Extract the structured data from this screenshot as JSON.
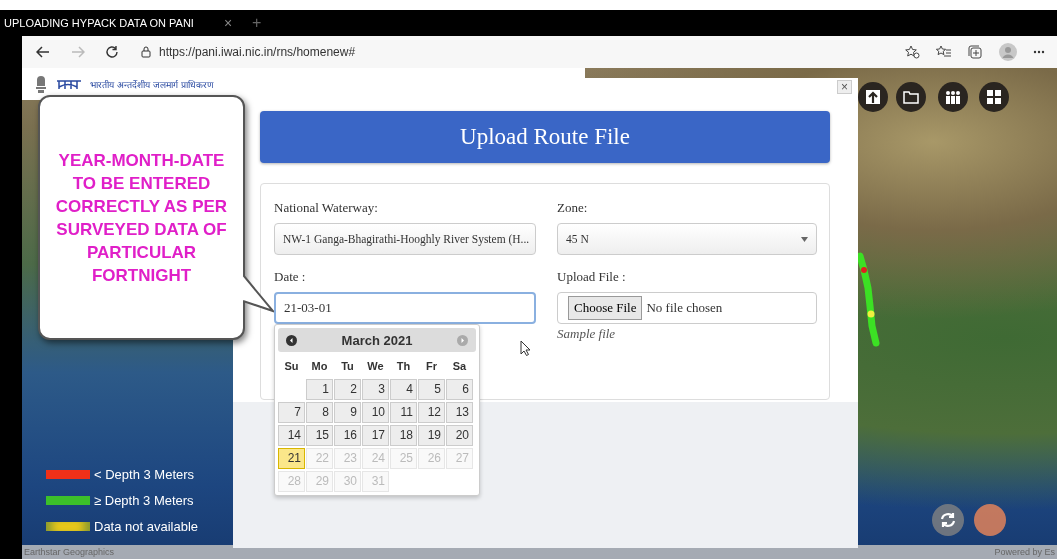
{
  "browser": {
    "tab_title": "UPLOADING HYPACK DATA ON PANI",
    "tab_close": "×",
    "new_tab": "+",
    "url": "https://pani.iwai.nic.in/rns/homenew#"
  },
  "page_header": {
    "org_name": "भारतीय अन्तर्देशीय जलमार्ग प्राधिकरण"
  },
  "callout": {
    "text": "YEAR-MONTH-DATE TO BE ENTERED CORRECTLY AS PER SURVEYED DATA OF PARTICULAR FORTNIGHT"
  },
  "modal": {
    "close": "×",
    "title": "Upload Route File",
    "fields": [
      {
        "label": "National Waterway:",
        "value": "NW-1 Ganga-Bhagirathi-Hooghly River System (H...",
        "kind": "select"
      },
      {
        "label": "Zone:",
        "value": "45 N",
        "kind": "select"
      },
      {
        "label": "Date :",
        "value": "21-03-01",
        "kind": "text"
      },
      {
        "label": "Upload File :",
        "value": "No file chosen",
        "button": "Choose File",
        "link": "Sample file",
        "kind": "file"
      }
    ]
  },
  "calendar": {
    "month": "March 2021",
    "weekdays": [
      "Su",
      "Mo",
      "Tu",
      "We",
      "Th",
      "Fr",
      "Sa"
    ],
    "weeks": [
      [
        {
          "day": "1",
          "disabled": false,
          "selected": false
        },
        {
          "day": "2",
          "disabled": false,
          "selected": false
        },
        {
          "day": "3",
          "disabled": false,
          "selected": false
        },
        {
          "day": "4",
          "disabled": false,
          "selected": false
        },
        {
          "day": "5",
          "disabled": false,
          "selected": false
        },
        {
          "day": "6",
          "disabled": false,
          "selected": false
        }
      ],
      [
        {
          "day": "7",
          "disabled": false,
          "selected": false
        },
        {
          "day": "8",
          "disabled": false,
          "selected": false
        },
        {
          "day": "9",
          "disabled": false,
          "selected": false
        },
        {
          "day": "10",
          "disabled": false,
          "selected": false
        },
        {
          "day": "11",
          "disabled": false,
          "selected": false
        },
        {
          "day": "12",
          "disabled": false,
          "selected": false
        },
        {
          "day": "13",
          "disabled": false,
          "selected": false
        }
      ],
      [
        {
          "day": "14",
          "disabled": false,
          "selected": false
        },
        {
          "day": "15",
          "disabled": false,
          "selected": false
        },
        {
          "day": "16",
          "disabled": false,
          "selected": false
        },
        {
          "day": "17",
          "disabled": false,
          "selected": false
        },
        {
          "day": "18",
          "disabled": false,
          "selected": false
        },
        {
          "day": "19",
          "disabled": false,
          "selected": false
        },
        {
          "day": "20",
          "disabled": false,
          "selected": false
        }
      ],
      [
        {
          "day": "21",
          "disabled": false,
          "selected": true
        },
        {
          "day": "22",
          "disabled": true,
          "selected": false
        },
        {
          "day": "23",
          "disabled": true,
          "selected": false
        },
        {
          "day": "24",
          "disabled": true,
          "selected": false
        },
        {
          "day": "25",
          "disabled": true,
          "selected": false
        },
        {
          "day": "26",
          "disabled": true,
          "selected": false
        },
        {
          "day": "27",
          "disabled": true,
          "selected": false
        }
      ],
      [
        {
          "day": "28",
          "disabled": true,
          "selected": false
        },
        {
          "day": "29",
          "disabled": true,
          "selected": false
        },
        {
          "day": "30",
          "disabled": true,
          "selected": false
        },
        {
          "day": "31",
          "disabled": true,
          "selected": false
        }
      ]
    ]
  },
  "legend": {
    "items": [
      {
        "label": "< Depth 3 Meters",
        "color": "#f03018"
      },
      {
        "label": "≥ Depth 3 Meters",
        "color": "#3cc02a"
      },
      {
        "label": "Data not available",
        "color": "#e8c81c"
      }
    ]
  },
  "map": {
    "attribution": "Earthstar Geographics",
    "powered_by": "Powered by Es"
  }
}
